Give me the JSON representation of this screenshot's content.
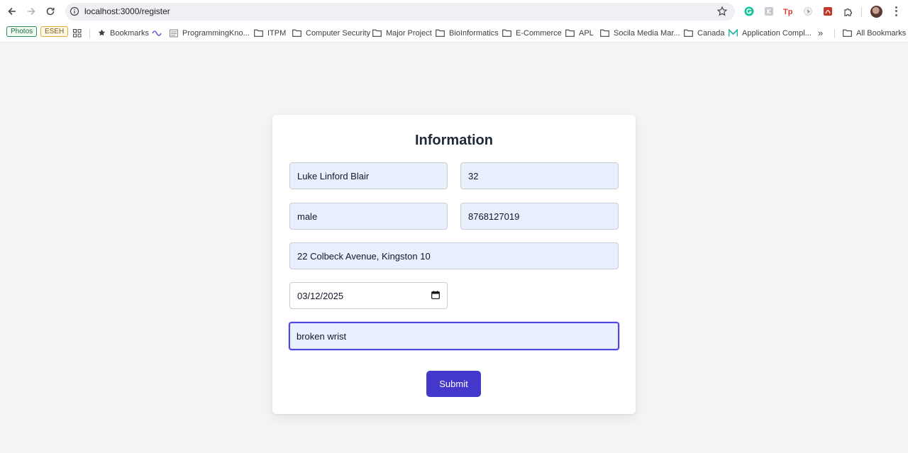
{
  "browser": {
    "url": "localhost:3000/register",
    "bookmarks": {
      "pills": [
        "Photos",
        "ESEH"
      ],
      "items": [
        "Bookmarks",
        "ProgrammingKno...",
        "ITPM",
        "Computer Security",
        "Major Project",
        "BioInformatics",
        "E-Commerce",
        "APL",
        "Socila Media Mar...",
        "Canada",
        "Application Compl..."
      ],
      "overflow": "»",
      "all_bookmarks": "All Bookmarks"
    }
  },
  "form": {
    "title": "Information",
    "fields": {
      "name": "Luke Linford Blair",
      "age": "32",
      "gender": "male",
      "phone": "8768127019",
      "address": "22 Colbeck Avenue, Kingston 10",
      "date": "03/12/2025",
      "condition": "broken wrist"
    },
    "submit_label": "Submit"
  },
  "colors": {
    "accent": "#4338ca",
    "autofill_bg": "#e8f0fe",
    "page_bg": "#f3f4f6"
  }
}
